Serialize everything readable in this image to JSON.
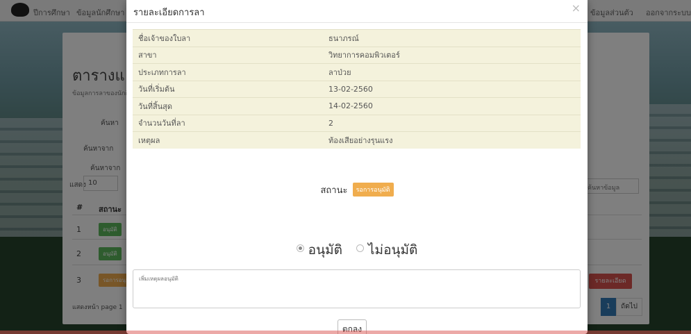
{
  "background_page": {
    "nav_items": [
      "ปีการศึกษา",
      "ข้อมูลนักศึกษา",
      "ข้อมูลส่วนตัว",
      "ออกจากระบบ"
    ],
    "card_title": "ตารางแ",
    "card_subtitle": "ข้อมูลการลาของนักศึกษา",
    "filters": [
      {
        "label": "ค้นหา"
      },
      {
        "label": "ค้นหาจาก"
      },
      {
        "label": "ค้นหาจาก"
      }
    ],
    "show_label": "แสดง",
    "show_value": "10",
    "columns": [
      "#",
      "สถานะ"
    ],
    "rows": [
      {
        "num": "1",
        "badge": "อนุมัติ",
        "badge_color": "#5cb85c"
      },
      {
        "num": "2",
        "badge": "อนุมัติ",
        "badge_color": "#5cb85c"
      },
      {
        "num": "3",
        "badge": "รอการอนุมัติ",
        "badge_color": "#f0ad4e"
      }
    ],
    "search_placeholder": "ค้นหาข้อมูล",
    "detail_button": "รายละเอียด",
    "footer_text": "แสดงหน้า page 1",
    "pagination": {
      "current": "1",
      "next": "ถัดไป"
    }
  },
  "modal": {
    "title": "รายละเอียดการลา",
    "close_symbol": "×",
    "details": [
      {
        "label": "ชื่อเจ้าของใบลา",
        "value": "ธนาภรณ์"
      },
      {
        "label": "สาขา",
        "value": "วิทยาการคอมพิวเตอร์"
      },
      {
        "label": "ประเภทการลา",
        "value": "ลาป่วย"
      },
      {
        "label": "วันที่เริ่มต้น",
        "value": "13-02-2560"
      },
      {
        "label": "วันที่สิ้นสุด",
        "value": "14-02-2560"
      },
      {
        "label": "จำนวนวันที่ลา",
        "value": "2"
      },
      {
        "label": "เหตุผล",
        "value": "ท้องเสียอย่างรุนแรง"
      }
    ],
    "status_label": "สถานะ",
    "status_value": "รอการอนุมัติ",
    "status_color": "#f0ad4e",
    "approve_label": "อนุมัติ",
    "reject_label": "ไม่อนุมัติ",
    "selected": "approve",
    "comment_placeholder": "เพิ่มเหตุผลอนุมัติ",
    "ok_button": "ตกลง"
  }
}
